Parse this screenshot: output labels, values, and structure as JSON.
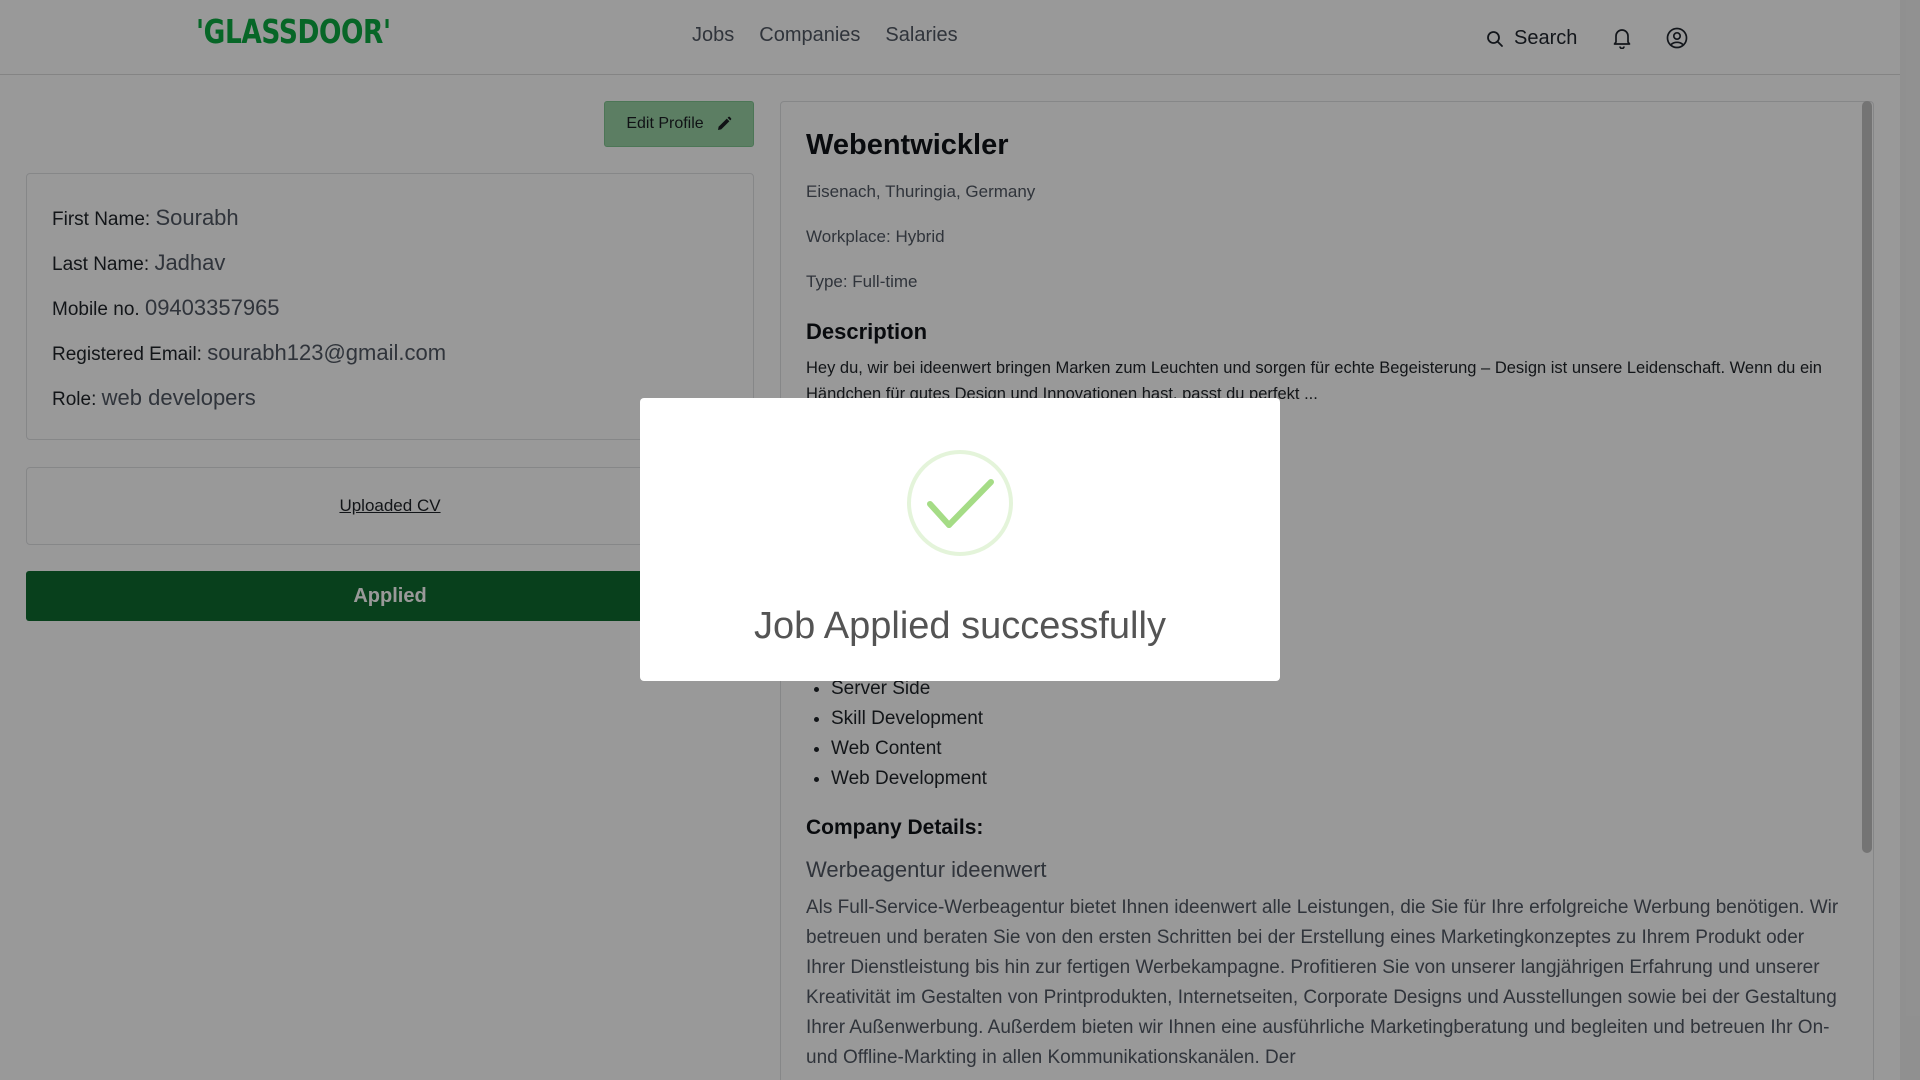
{
  "header": {
    "logo": "'GLASSDOOR'",
    "nav": [
      "Jobs",
      "Companies",
      "Salaries"
    ],
    "search_label": "Search",
    "bell_icon": "bell-icon",
    "user_icon": "user-circle-icon"
  },
  "profile": {
    "edit_label": "Edit Profile",
    "first_name_label": "First Name:",
    "first_name": "Sourabh",
    "last_name_label": "Last Name:",
    "last_name": "Jadhav",
    "mobile_label": "Mobile no.",
    "mobile": "09403357965",
    "email_label": "Registered Email:",
    "email": "sourabh123@gmail.com",
    "role_label": "Role:",
    "role": "web developers",
    "cv_label": "Uploaded CV",
    "applied_label": "Applied"
  },
  "job": {
    "title": "Webentwickler",
    "location": "Eisenach, Thuringia, Germany",
    "workplace": "Workplace: Hybrid",
    "type": "Type: Full-time",
    "description_heading": "Description",
    "description": "Hey du, wir bei ideenwert bringen Marken zum Leuchten und sorgen für echte Begeisterung – Design ist unsere Leidenschaft. Wenn du ein Händchen für gutes Design und Innovationen hast, passt du perfekt ...",
    "skills": [
      "Server Side",
      "Skill Development",
      "Web Content",
      "Web Development"
    ],
    "company_heading": "Company Details:",
    "company_name": "Werbeagentur ideenwert",
    "company_description": "Als Full-Service-Werbeagentur bietet Ihnen ideenwert alle Leistungen, die Sie für Ihre erfolgreiche Werbung benötigen. Wir betreuen und beraten Sie von den ersten Schritten bei der Erstellung eines Marketingkonzeptes zu Ihrem Produkt oder Ihrer Dienstleistung bis hin zur fertigen Werbekampagne. Profitieren Sie von unserer langjährigen Erfahrung und unserer Kreativität im Gestalten von Printprodukten, Internetseiten, Corporate Designs und Ausstellungen sowie bei der Gestaltung Ihrer Außenwerbung. Außerdem bieten wir Ihnen eine ausführliche Marketingberatung und begleiten und betreuen Ihr On- und Offline-Markting in allen Kommunikationskanälen. Der"
  },
  "modal": {
    "message": "Job Applied successfully",
    "icon": "success-check-icon",
    "accent": "#a5dc86"
  },
  "colors": {
    "brand": "#0caa41",
    "applied_button": "#0e6b2f",
    "edit_button": "#9ad3a6"
  }
}
